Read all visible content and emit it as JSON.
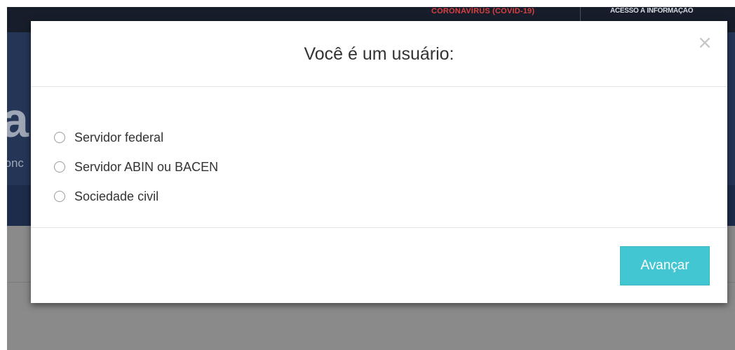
{
  "background": {
    "topbar": {
      "covid_link": "CORONAVÍRUS (COVID-19)",
      "access_link": "ACESSO À INFORMAÇÃO"
    },
    "hero": {
      "title_fragment": "al",
      "subtitle_fragment": "conc"
    }
  },
  "modal": {
    "title": "Você é um usuário:",
    "close_label": "×",
    "options": [
      {
        "label": "Servidor federal",
        "checked": false
      },
      {
        "label": "Servidor ABIN ou BACEN",
        "checked": false
      },
      {
        "label": "Sociedade civil",
        "checked": false
      }
    ],
    "advance_button": "Avançar"
  },
  "colors": {
    "accent": "#42c6d1",
    "topbar": "#171d2a",
    "hero": "#243556",
    "overlay_content": "#8a8a8a"
  }
}
